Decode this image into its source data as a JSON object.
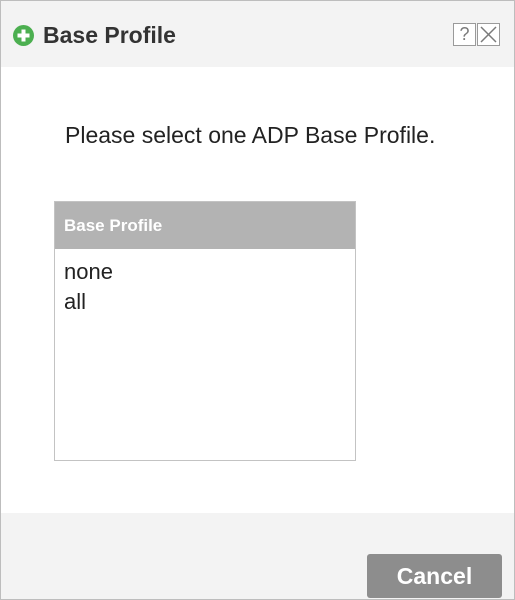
{
  "dialog": {
    "title": "Base Profile",
    "title_icon": "add-circle-icon",
    "help_label": "?",
    "close_icon": "close-icon"
  },
  "message": "Please select one ADP Base Profile.",
  "profile_list": {
    "header": "Base Profile",
    "items": [
      "none",
      "all"
    ]
  },
  "footer": {
    "cancel_label": "Cancel"
  },
  "colors": {
    "accent_green": "#4caf50",
    "header_gray": "#b3b3b3",
    "button_gray": "#8d8d8d"
  }
}
